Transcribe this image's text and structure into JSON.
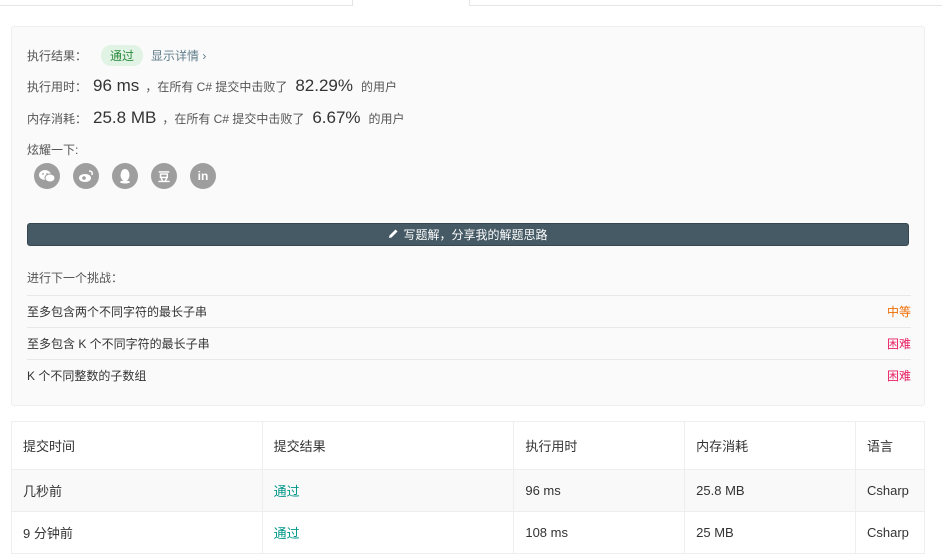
{
  "result": {
    "label": "执行结果：",
    "status": "通过",
    "detail_link": "显示详情 ›"
  },
  "runtime": {
    "label": "执行用时：",
    "value": "96 ms",
    "mid": "，在所有 C# 提交中击败了",
    "percent": "82.29%",
    "tail": "的用户"
  },
  "memory": {
    "label": "内存消耗：",
    "value": "25.8 MB",
    "mid": "，在所有 C# 提交中击败了",
    "percent": "6.67%",
    "tail": "的用户"
  },
  "share": {
    "label": "炫耀一下:",
    "icons": [
      "wechat-icon",
      "weibo-icon",
      "qq-icon",
      "douban-icon",
      "linkedin-icon"
    ],
    "douban_glyph": "豆",
    "linkedin_glyph": "in",
    "button_label": "写题解，分享我的解题思路"
  },
  "next": {
    "label": "进行下一个挑战：",
    "problems": [
      {
        "title": "至多包含两个不同字符的最长子串",
        "difficulty": "中等"
      },
      {
        "title": "至多包含 K 个不同字符的最长子串",
        "difficulty": "困难"
      },
      {
        "title": "K 个不同整数的子数组",
        "difficulty": "困难"
      }
    ]
  },
  "submissions": {
    "headers": [
      "提交时间",
      "提交结果",
      "执行用时",
      "内存消耗",
      "语言"
    ],
    "rows": [
      {
        "time": "几秒前",
        "result": "通过",
        "runtime": "96 ms",
        "memory": "25.8 MB",
        "lang": "Csharp"
      },
      {
        "time": "9 分钟前",
        "result": "通过",
        "runtime": "108 ms",
        "memory": "25 MB",
        "lang": "Csharp"
      }
    ]
  },
  "colors": {
    "accent_dark": "#455a64",
    "pass_green": "#2b8a3e",
    "medium": "#ef6c00",
    "hard": "#e91e63",
    "table_pass": "#009688"
  }
}
